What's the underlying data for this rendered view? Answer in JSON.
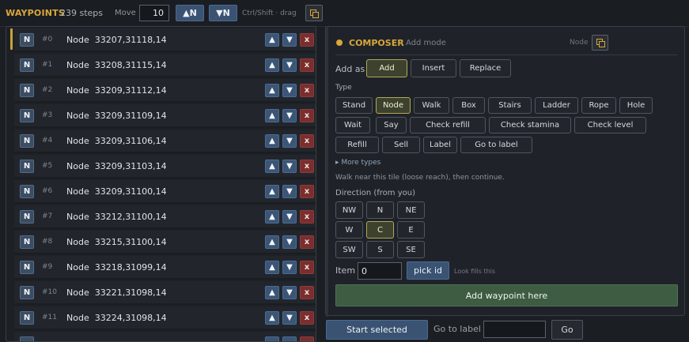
{
  "header": {
    "title": "WAYPOINTS",
    "steps": "239 steps",
    "move_label": "Move",
    "move_value": "10",
    "up_n_label": "▲N",
    "down_n_label": "▼N",
    "hint": "Ctrl/Shift · drag",
    "copy_icon": "copy-icon"
  },
  "waypoints": [
    {
      "badge": "N",
      "index": "#0",
      "text": "Node  33207,31118,14"
    },
    {
      "badge": "N",
      "index": "#1",
      "text": "Node  33208,31115,14"
    },
    {
      "badge": "N",
      "index": "#2",
      "text": "Node  33209,31112,14"
    },
    {
      "badge": "N",
      "index": "#3",
      "text": "Node  33209,31109,14"
    },
    {
      "badge": "N",
      "index": "#4",
      "text": "Node  33209,31106,14"
    },
    {
      "badge": "N",
      "index": "#5",
      "text": "Node  33209,31103,14"
    },
    {
      "badge": "N",
      "index": "#6",
      "text": "Node  33209,31100,14"
    },
    {
      "badge": "N",
      "index": "#7",
      "text": "Node  33212,31100,14"
    },
    {
      "badge": "N",
      "index": "#8",
      "text": "Node  33215,31100,14"
    },
    {
      "badge": "N",
      "index": "#9",
      "text": "Node  33218,31099,14"
    },
    {
      "badge": "N",
      "index": "#10",
      "text": "Node  33221,31098,14"
    },
    {
      "badge": "N",
      "index": "#11",
      "text": "Node  33224,31098,14"
    }
  ],
  "row_controls": {
    "up": "▲",
    "down": "▼",
    "delete": "x"
  },
  "composer": {
    "title": "COMPOSER",
    "mode": "Add mode",
    "node_tag": "Node",
    "add_as_label": "Add as",
    "add_as": [
      "Add",
      "Insert",
      "Replace"
    ],
    "add_as_selected": "Add",
    "type_label": "Type",
    "types_row1": [
      "Stand",
      "Node",
      "Walk",
      "Box",
      "Stairs",
      "Ladder",
      "Rope",
      "Hole"
    ],
    "types_row2": [
      "Wait",
      "Say",
      "Check refill",
      "Check stamina",
      "Check level"
    ],
    "types_row3": [
      "Refill",
      "Sell",
      "Label",
      "Go to label"
    ],
    "type_selected": "Node",
    "more_types": "▸ More types",
    "description": "Walk near this tile (loose reach), then continue.",
    "direction_label": "Direction (from you)",
    "directions": [
      "NW",
      "N",
      "NE",
      "W",
      "C",
      "E",
      "SW",
      "S",
      "SE"
    ],
    "direction_selected": "C",
    "item_label": "Item",
    "item_value": "0",
    "pick_id_label": "pick id",
    "look_hint": "Look fills this",
    "add_button": "Add waypoint here"
  },
  "footer": {
    "start_selected": "Start selected",
    "goto_label": "Go to label",
    "goto_value": "",
    "go_button": "Go"
  },
  "colors": {
    "accent_gold": "#d9a73a",
    "button_blue": "#3a5373",
    "delete_red": "#7a2e2e",
    "add_green": "#3d5c42"
  }
}
